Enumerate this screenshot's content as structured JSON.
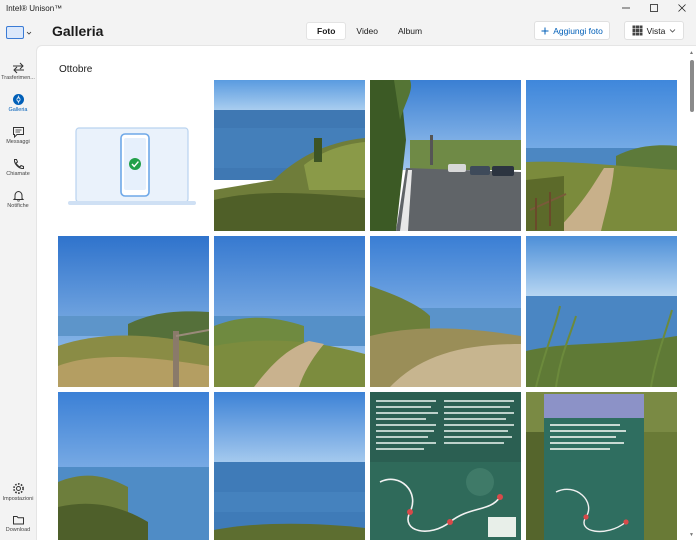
{
  "app": {
    "title": "Intel® Unison™"
  },
  "window_controls": {
    "minimize": "minimize-icon",
    "maximize": "maximize-icon",
    "close": "close-icon"
  },
  "rail": {
    "device_icon": "laptop-device-icon",
    "items": [
      {
        "label": "Trasferimen...",
        "icon": "transfer-icon",
        "active": false
      },
      {
        "label": "Galleria",
        "icon": "gallery-icon",
        "active": true
      },
      {
        "label": "Messaggi",
        "icon": "message-icon",
        "active": false
      },
      {
        "label": "Chiamate",
        "icon": "phone-icon",
        "active": false
      },
      {
        "label": "Notifiche",
        "icon": "bell-icon",
        "active": false
      }
    ],
    "bottom_items": [
      {
        "label": "Impostazioni",
        "icon": "gear-icon"
      },
      {
        "label": "Download",
        "icon": "folder-icon"
      }
    ]
  },
  "header": {
    "title": "Galleria",
    "tabs": [
      {
        "label": "Foto",
        "active": true
      },
      {
        "label": "Video",
        "active": false
      },
      {
        "label": "Album",
        "active": false
      }
    ],
    "add_button": "Aggiungi foto",
    "view_button": "Vista"
  },
  "gallery": {
    "section_title": "Ottobre",
    "tiles": [
      {
        "type": "placeholder",
        "icon": "phone-on-laptop-check-icon"
      },
      {
        "type": "photo",
        "scene": "sea-coast-hill"
      },
      {
        "type": "photo",
        "scene": "road-with-cars"
      },
      {
        "type": "photo",
        "scene": "path-to-headland"
      },
      {
        "type": "photo",
        "scene": "cliff-with-fence"
      },
      {
        "type": "photo",
        "scene": "cliff-trail-sea"
      },
      {
        "type": "photo",
        "scene": "cliff-edge-grass"
      },
      {
        "type": "photo",
        "scene": "sea-grass-foreground"
      },
      {
        "type": "photo",
        "scene": "headland-sea"
      },
      {
        "type": "photo",
        "scene": "sea-horizon"
      },
      {
        "type": "photo",
        "scene": "trail-map-sign"
      },
      {
        "type": "photo",
        "scene": "school-path-sign"
      }
    ],
    "sign_heading": "SENTIERO DE LA NUOVA SCUOLA \"LAUDATO SI' MI' SIGNORE\""
  },
  "colors": {
    "accent": "#005fb8",
    "sky": "#4a8fd9",
    "sea": "#2f6ea8",
    "grass": "#7a8a3a"
  }
}
